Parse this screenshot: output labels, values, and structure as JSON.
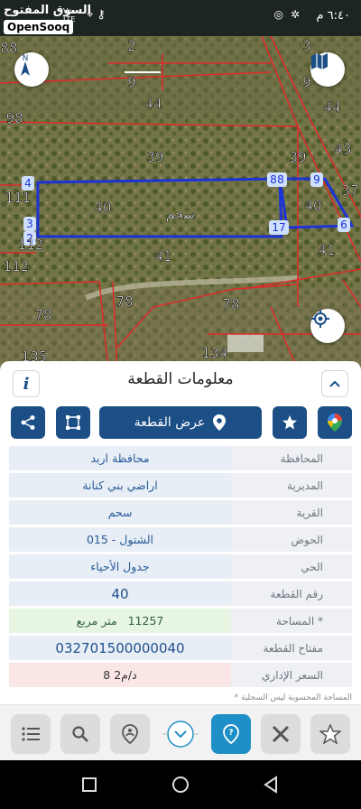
{
  "status_bar": {
    "time": "٦:٤٠ م",
    "network_top": "Vo",
    "network_bottom": "LTE",
    "signal_text": "4G"
  },
  "brand": {
    "arabic": "السوق المفتوح",
    "latin": "OpenSooq"
  },
  "map": {
    "parcel_labels": [
      "88",
      "2",
      "3",
      "9",
      "9",
      "44",
      "98",
      "44",
      "39",
      "43",
      "39",
      "37",
      "111",
      "40",
      "40",
      "112",
      "41",
      "41",
      "112",
      "78",
      "78",
      "78",
      "135",
      "134"
    ],
    "selected_name": "سحم",
    "selected_number": "40",
    "vertices": [
      "4",
      "8",
      "8",
      "9",
      "3",
      "2",
      "17",
      "6"
    ],
    "colors": {
      "parcel_outline": "#1d33d6",
      "boundary": "#e02a2a"
    }
  },
  "sheet": {
    "title": "معلومات القطعة",
    "show_parcel_label": "عرض القطعة",
    "rows": [
      {
        "label": "المحافظة",
        "value": "محافظة اربد"
      },
      {
        "label": "المديرية",
        "value": "اراضي بني كنانة"
      },
      {
        "label": "القرية",
        "value": "سحم"
      },
      {
        "label": "الحوض",
        "value": "الشتول - 015"
      },
      {
        "label": "الحي",
        "value": "جدول الأحياء"
      },
      {
        "label": "رقم القطعة",
        "value": "40"
      },
      {
        "label": "المساحة *",
        "value_number": "11257",
        "value_unit": "متر مربع"
      },
      {
        "label": "مفتاح القطعة",
        "value": "032701500000040"
      },
      {
        "label": "السعر الإداري",
        "value": "8 د/م2"
      }
    ],
    "footnote": "* المساحة المحسوبة ليس السجلية"
  },
  "colors": {
    "primary": "#1b4f86",
    "accent": "#1f8fc7",
    "area_bg": "#e7f6e2",
    "price_bg": "#fbe6e6"
  }
}
